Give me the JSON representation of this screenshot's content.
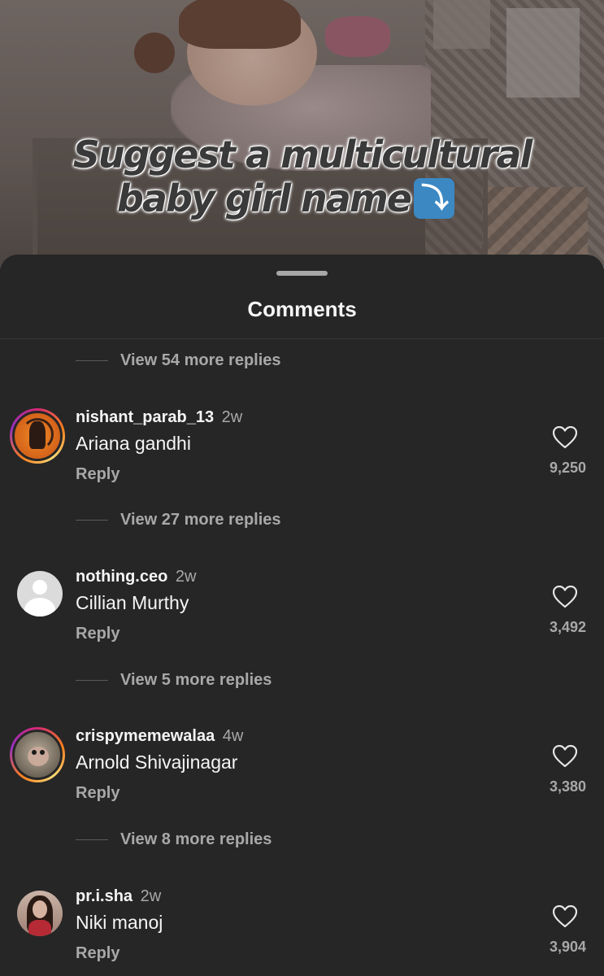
{
  "video": {
    "overlay_line1": "Suggest a multicultural",
    "overlay_line2": "baby girl name",
    "overlay_emoji": "⤵"
  },
  "sheet": {
    "title": "Comments"
  },
  "threads": [
    {
      "view_replies": "View 54 more replies"
    },
    {
      "view_replies": "View 27 more replies"
    },
    {
      "view_replies": "View 5 more replies"
    },
    {
      "view_replies": "View 8 more replies"
    }
  ],
  "comments": [
    {
      "username": "nishant_parab_13",
      "time": "2w",
      "text": "Ariana gandhi",
      "reply_label": "Reply",
      "likes": "9,250",
      "avatar": "archer-avatar",
      "story_ring": true
    },
    {
      "username": "nothing.ceo",
      "time": "2w",
      "text": "Cillian Murthy",
      "reply_label": "Reply",
      "likes": "3,492",
      "avatar": "default-avatar",
      "story_ring": false
    },
    {
      "username": "crispymemewalaa",
      "time": "4w",
      "text": "Arnold Shivajinagar",
      "reply_label": "Reply",
      "likes": "3,380",
      "avatar": "monkey-avatar",
      "story_ring": true
    },
    {
      "username": "pr.i.sha",
      "time": "2w",
      "text": "Niki manoj",
      "reply_label": "Reply",
      "likes": "3,904",
      "avatar": "selfie-avatar",
      "story_ring": false
    }
  ],
  "colors": {
    "sheet_bg": "#262626",
    "primary_text": "#f5f5f5",
    "secondary_text": "#a8a8a8",
    "story_ring": [
      "#d62976",
      "#fa7e1e",
      "#feda75",
      "#962fbf"
    ],
    "emoji_blue": "#3b88c3"
  }
}
